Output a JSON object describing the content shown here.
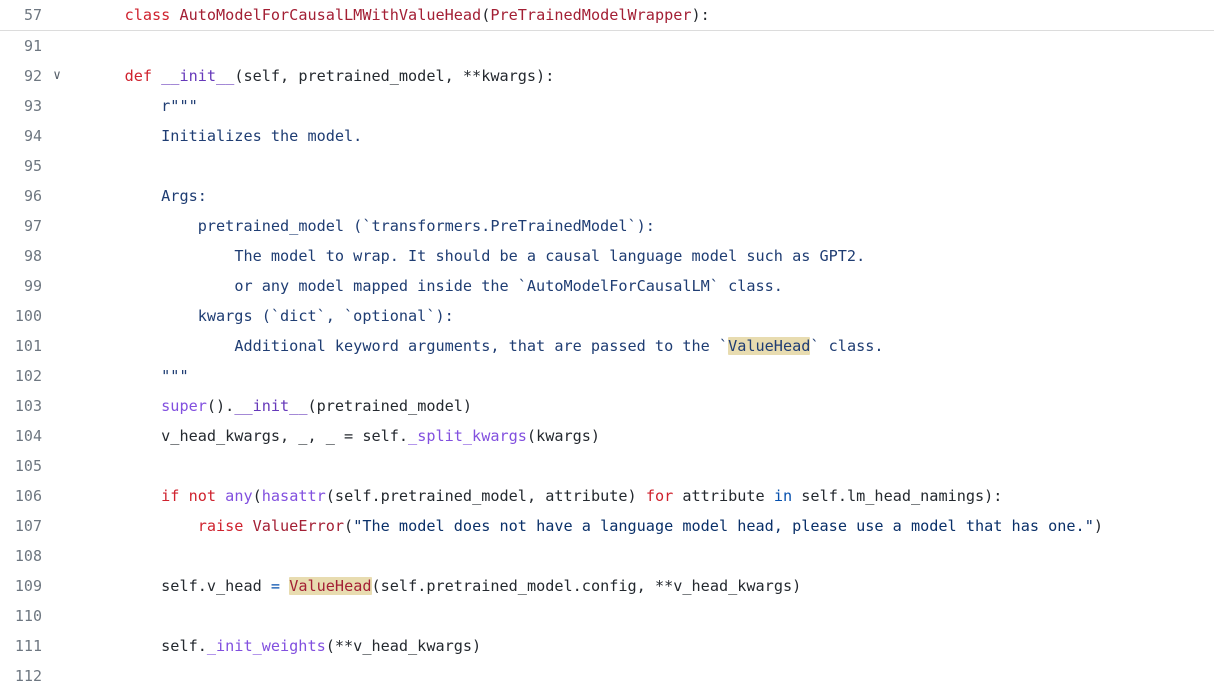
{
  "editor": {
    "language": "python",
    "sticky_header_line": "57",
    "search_match_term": "ValueHead",
    "highlight_color": "#e8dcb0",
    "background_color": "#ffffff",
    "gutter_color": "#6e7781",
    "fold_icon": "chevron-down-icon",
    "fold_glyph": "∨"
  },
  "sticky": {
    "number": "57",
    "tokens": [
      {
        "text": "class ",
        "cls": "t-kw"
      },
      {
        "text": "AutoModelForCausalLMWithValueHead",
        "cls": "t-cls"
      },
      {
        "text": "(",
        "cls": "t-plain"
      },
      {
        "text": "PreTrainedModelWrapper",
        "cls": "t-cls"
      },
      {
        "text": "):",
        "cls": "t-plain"
      }
    ],
    "plain_text": "class AutoModelForCausalLMWithValueHead(PreTrainedModelWrapper):"
  },
  "lines": [
    {
      "number": "91",
      "fold": "",
      "indent": 0,
      "plain_text": "",
      "tokens": []
    },
    {
      "number": "92",
      "fold": "∨",
      "indent": 4,
      "plain_text": "    def __init__(self, pretrained_model, **kwargs):",
      "tokens": [
        {
          "text": "def ",
          "cls": "t-kw"
        },
        {
          "text": "__init__",
          "cls": "t-dunder"
        },
        {
          "text": "(self, pretrained_model, **kwargs):",
          "cls": "t-plain"
        }
      ]
    },
    {
      "number": "93",
      "fold": "",
      "indent": 8,
      "plain_text": "        r\"\"\"",
      "tokens": [
        {
          "text": "r\"\"\"",
          "cls": "t-doc"
        }
      ]
    },
    {
      "number": "94",
      "fold": "",
      "indent": 8,
      "plain_text": "        Initializes the model.",
      "tokens": [
        {
          "text": "Initializes the model.",
          "cls": "t-doc"
        }
      ]
    },
    {
      "number": "95",
      "fold": "",
      "indent": 0,
      "plain_text": "",
      "tokens": []
    },
    {
      "number": "96",
      "fold": "",
      "indent": 8,
      "plain_text": "        Args:",
      "tokens": [
        {
          "text": "Args:",
          "cls": "t-doc"
        }
      ]
    },
    {
      "number": "97",
      "fold": "",
      "indent": 12,
      "plain_text": "            pretrained_model (`transformers.PreTrainedModel`):",
      "tokens": [
        {
          "text": "pretrained_model (`transformers.PreTrainedModel`):",
          "cls": "t-doc"
        }
      ]
    },
    {
      "number": "98",
      "fold": "",
      "indent": 16,
      "plain_text": "                The model to wrap. It should be a causal language model such as GPT2.",
      "tokens": [
        {
          "text": "The model to wrap. It should be a causal language model such as GPT2.",
          "cls": "t-doc"
        }
      ]
    },
    {
      "number": "99",
      "fold": "",
      "indent": 16,
      "plain_text": "                or any model mapped inside the `AutoModelForCausalLM` class.",
      "tokens": [
        {
          "text": "or any model mapped inside the `AutoModelForCausalLM` class.",
          "cls": "t-doc"
        }
      ]
    },
    {
      "number": "100",
      "fold": "",
      "indent": 12,
      "plain_text": "            kwargs (`dict`, `optional`):",
      "tokens": [
        {
          "text": "kwargs (`dict`, `optional`):",
          "cls": "t-doc"
        }
      ]
    },
    {
      "number": "101",
      "fold": "",
      "indent": 16,
      "plain_text": "                Additional keyword arguments, that are passed to the `ValueHead` class.",
      "tokens": [
        {
          "text": "Additional keyword arguments, that are passed to the `",
          "cls": "t-doc"
        },
        {
          "text": "ValueHead",
          "cls": "t-doc",
          "highlight": true
        },
        {
          "text": "` class.",
          "cls": "t-doc"
        }
      ]
    },
    {
      "number": "102",
      "fold": "",
      "indent": 8,
      "plain_text": "        \"\"\"",
      "tokens": [
        {
          "text": "\"\"\"",
          "cls": "t-doc"
        }
      ]
    },
    {
      "number": "103",
      "fold": "",
      "indent": 8,
      "plain_text": "        super().__init__(pretrained_model)",
      "tokens": [
        {
          "text": "super",
          "cls": "t-fn"
        },
        {
          "text": "().",
          "cls": "t-plain"
        },
        {
          "text": "__init__",
          "cls": "t-dunder"
        },
        {
          "text": "(pretrained_model)",
          "cls": "t-plain"
        }
      ]
    },
    {
      "number": "104",
      "fold": "",
      "indent": 8,
      "plain_text": "        v_head_kwargs, _, _ = self._split_kwargs(kwargs)",
      "tokens": [
        {
          "text": "v_head_kwargs, _, _ = self.",
          "cls": "t-plain"
        },
        {
          "text": "_split_kwargs",
          "cls": "t-fn"
        },
        {
          "text": "(kwargs)",
          "cls": "t-plain"
        }
      ]
    },
    {
      "number": "105",
      "fold": "",
      "indent": 0,
      "plain_text": "",
      "tokens": []
    },
    {
      "number": "106",
      "fold": "",
      "indent": 8,
      "plain_text": "        if not any(hasattr(self.pretrained_model, attribute) for attribute in self.lm_head_namings):",
      "tokens": [
        {
          "text": "if not ",
          "cls": "t-kw"
        },
        {
          "text": "any",
          "cls": "t-fn"
        },
        {
          "text": "(",
          "cls": "t-plain"
        },
        {
          "text": "hasattr",
          "cls": "t-fn"
        },
        {
          "text": "(self.pretrained_model, attribute) ",
          "cls": "t-plain"
        },
        {
          "text": "for",
          "cls": "t-kw"
        },
        {
          "text": " attribute ",
          "cls": "t-plain"
        },
        {
          "text": "in",
          "cls": "t-kw2"
        },
        {
          "text": " self.lm_head_namings):",
          "cls": "t-plain"
        }
      ]
    },
    {
      "number": "107",
      "fold": "",
      "indent": 12,
      "plain_text": "            raise ValueError(\"The model does not have a language model head, please use a model that has one.\")",
      "tokens": [
        {
          "text": "raise ",
          "cls": "t-kw"
        },
        {
          "text": "ValueError",
          "cls": "t-cls"
        },
        {
          "text": "(",
          "cls": "t-plain"
        },
        {
          "text": "\"The model does not have a language model head, please use a model that has one.\"",
          "cls": "t-str"
        },
        {
          "text": ")",
          "cls": "t-plain"
        }
      ]
    },
    {
      "number": "108",
      "fold": "",
      "indent": 0,
      "plain_text": "",
      "tokens": []
    },
    {
      "number": "109",
      "fold": "",
      "indent": 8,
      "plain_text": "        self.v_head = ValueHead(self.pretrained_model.config, **v_head_kwargs)",
      "tokens": [
        {
          "text": "self.v_head ",
          "cls": "t-plain"
        },
        {
          "text": "=",
          "cls": "t-kw2"
        },
        {
          "text": " ",
          "cls": "t-plain"
        },
        {
          "text": "ValueHead",
          "cls": "t-cls",
          "highlight": true
        },
        {
          "text": "(self.pretrained_model.config, **v_head_kwargs)",
          "cls": "t-plain"
        }
      ]
    },
    {
      "number": "110",
      "fold": "",
      "indent": 0,
      "plain_text": "",
      "tokens": []
    },
    {
      "number": "111",
      "fold": "",
      "indent": 8,
      "plain_text": "        self._init_weights(**v_head_kwargs)",
      "tokens": [
        {
          "text": "self.",
          "cls": "t-plain"
        },
        {
          "text": "_init_weights",
          "cls": "t-fn"
        },
        {
          "text": "(**v_head_kwargs)",
          "cls": "t-plain"
        }
      ]
    },
    {
      "number": "112",
      "fold": "",
      "indent": 0,
      "plain_text": "",
      "tokens": [],
      "partial": true
    }
  ]
}
